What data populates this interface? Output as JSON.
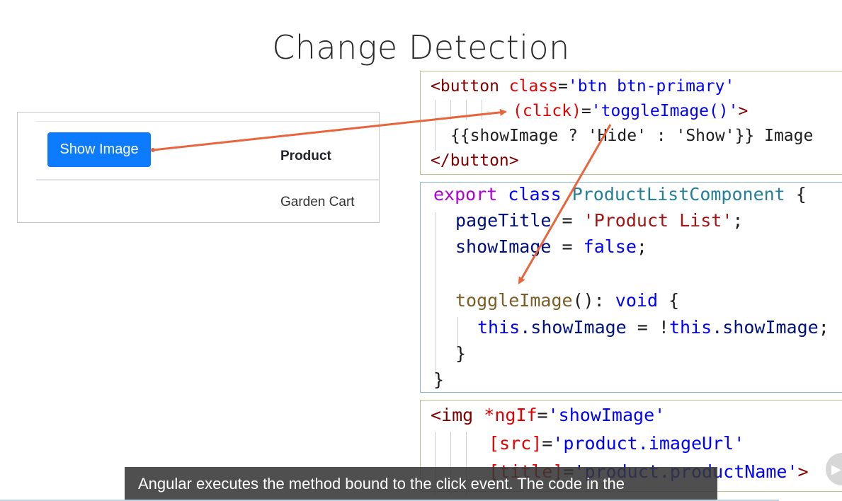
{
  "slide": {
    "title": "Change Detection"
  },
  "demo": {
    "button_label": "Show Image",
    "column_header": "Product",
    "row_cell": "Garden Cart"
  },
  "code_template": {
    "l1_tag": "<button",
    "l1_attr": "class",
    "l1_eq": "=",
    "l1_val": "'btn btn-primary'",
    "l2_attr": "(click)",
    "l2_eq": "=",
    "l2_val": "'toggleImage()'",
    "l2_close": ">",
    "l3_text": "{{showImage ? 'Hide' : 'Show'}} Image",
    "l4_tag": "</button>"
  },
  "code_component": {
    "l1_export": "export",
    "l1_class": "class",
    "l1_name": "ProductListComponent",
    "l1_brace": "{",
    "l2_prop": "pageTitle",
    "l2_eq": "=",
    "l2_str": "'Product List'",
    "l2_semi": ";",
    "l3_prop": "showImage",
    "l3_eq": "=",
    "l3_val": "false",
    "l3_semi": ";",
    "l5_fn": "toggleImage",
    "l5_paren": "():",
    "l5_type": "void",
    "l5_brace": "{",
    "l6_this1": "this",
    "l6_prop1": ".showImage",
    "l6_eq": "=",
    "l6_not": "!",
    "l6_this2": "this",
    "l6_prop2": ".showImage",
    "l6_semi": ";",
    "l7_brace": "}",
    "l8_brace": "}"
  },
  "code_img": {
    "l1_tag": "<img",
    "l1_attr": "*ngIf",
    "l1_eq": "=",
    "l1_val": "'showImage'",
    "l2_attr": "[src]",
    "l2_eq": "=",
    "l2_val": "'product.imageUrl'",
    "l3_attr": "[title]",
    "l3_eq": "=",
    "l3_val": "'product.productName'",
    "l3_close": ">"
  },
  "caption": "Angular executes the method bound to the click event. The code in the",
  "colors": {
    "arrow": "#e8643c",
    "button": "#0d7bff",
    "caption_bg": "#373737"
  }
}
